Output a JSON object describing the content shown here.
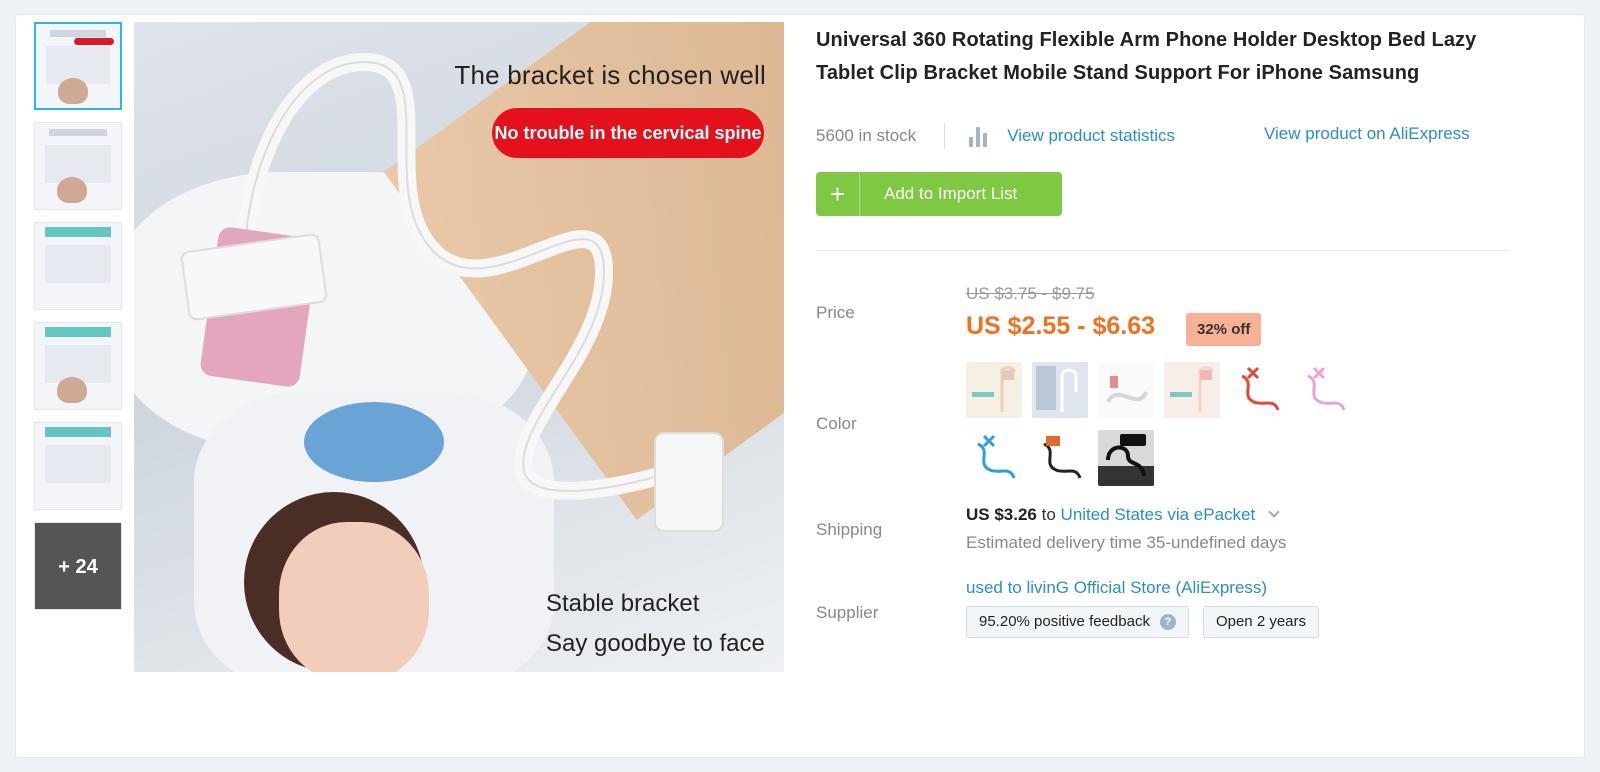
{
  "thumbnails": {
    "more_label": "+ 24"
  },
  "image": {
    "heading": "The bracket is chosen well",
    "pill": "No trouble in the cervical spine",
    "bottom_line1": "Stable bracket",
    "bottom_line2": "Say goodbye to face"
  },
  "product": {
    "title": "Universal 360 Rotating Flexible Arm Phone Holder Desktop Bed Lazy Tablet Clip Bracket Mobile Stand Support For iPhone Samsung",
    "stock": "5600 in stock",
    "stats_link": "View product statistics",
    "ali_link": "View product on AliExpress",
    "import_button": "Add to Import List",
    "import_icon": "plus-icon"
  },
  "price": {
    "label": "Price",
    "original": "US $3.75 - $9.75",
    "current": "US $2.55 - $6.63",
    "discount": "32% off",
    "current_color": "#f2701f",
    "badge_color": "#f8b197"
  },
  "color": {
    "label": "Color",
    "swatches": [
      {
        "name": "light-gold",
        "tone": "#e8d3b6"
      },
      {
        "name": "silver-grey",
        "tone": "#c8d2de"
      },
      {
        "name": "white",
        "tone": "#f2f2f2"
      },
      {
        "name": "rose-gold",
        "tone": "#f0d4c6"
      },
      {
        "name": "red",
        "tone": "#e8463a"
      },
      {
        "name": "pink",
        "tone": "#e9a3d9"
      },
      {
        "name": "blue",
        "tone": "#2b9fe0"
      },
      {
        "name": "black",
        "tone": "#222222"
      },
      {
        "name": "black-photo",
        "tone": "#111111"
      }
    ]
  },
  "shipping": {
    "label": "Shipping",
    "price": "US $3.26",
    "to_word": "to",
    "destination": "United States via ePacket",
    "delivery": "Estimated delivery time 35-undefined days"
  },
  "supplier": {
    "label": "Supplier",
    "name": "used to livinG Official Store (AliExpress)",
    "feedback": "95.20% positive feedback",
    "help_icon": "?",
    "open": "Open 2 years"
  },
  "colors": {
    "link": "#2a8dd3",
    "button_green": "#7ec843",
    "active_thumb_border": "#2bb5e8"
  }
}
